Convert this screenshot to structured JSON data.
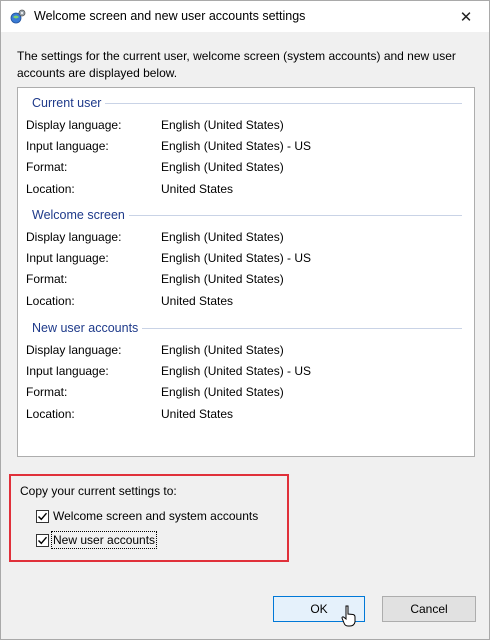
{
  "window": {
    "title": "Welcome screen and new user accounts settings",
    "close_glyph": "✕"
  },
  "intro": "The settings for the current user, welcome screen (system accounts) and new user accounts are displayed below.",
  "groups": [
    {
      "header": "Current user",
      "rows": [
        {
          "label": "Display language:",
          "value": "English (United States)"
        },
        {
          "label": "Input language:",
          "value": "English (United States) - US"
        },
        {
          "label": "Format:",
          "value": "English (United States)"
        },
        {
          "label": "Location:",
          "value": "United States"
        }
      ]
    },
    {
      "header": "Welcome screen",
      "rows": [
        {
          "label": "Display language:",
          "value": "English (United States)"
        },
        {
          "label": "Input language:",
          "value": "English (United States) - US"
        },
        {
          "label": "Format:",
          "value": "English (United States)"
        },
        {
          "label": "Location:",
          "value": "United States"
        }
      ]
    },
    {
      "header": "New user accounts",
      "rows": [
        {
          "label": "Display language:",
          "value": "English (United States)"
        },
        {
          "label": "Input language:",
          "value": "English (United States) - US"
        },
        {
          "label": "Format:",
          "value": "English (United States)"
        },
        {
          "label": "Location:",
          "value": "United States"
        }
      ]
    }
  ],
  "copy": {
    "label": "Copy your current settings to:",
    "options": [
      {
        "label": "Welcome screen and system accounts",
        "checked": true
      },
      {
        "label": "New user accounts",
        "checked": true
      }
    ]
  },
  "buttons": {
    "ok": "OK",
    "cancel": "Cancel"
  },
  "colors": {
    "group_header": "#1e3a8a",
    "highlight_border": "#e0303a",
    "default_button_border": "#0078d7"
  }
}
